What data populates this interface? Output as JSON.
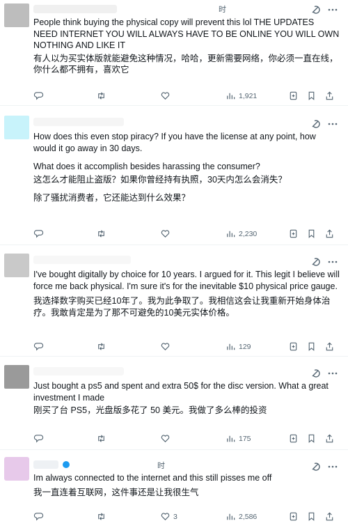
{
  "posts": [
    {
      "avatar_color": "#bdbdbd",
      "time": "时",
      "lines": [
        "People think buying the physical copy will prevent this lol THE UPDATES NEED INTERNET YOU WILL ALWAYS HAVE TO BE ONLINE YOU WILL OWN NOTHING AND LIKE IT",
        "有人以为买实体版就能避免这种情况，哈哈，更新需要网络，你必须一直在线，你什么都不拥有，喜欢它"
      ],
      "reply_count": "",
      "retweet_count": "",
      "like_count": "",
      "view_count": "1,921"
    },
    {
      "avatar_color": "#c8f3fb",
      "time": "",
      "lines": [
        "How does this even stop piracy? If you have the license at any point, how would it go away in 30 days.",
        "What does it accomplish besides harassing the consumer?",
        "这怎么才能阻止盗版？如果你曾经持有执照，30天内怎么会消失？",
        "除了骚扰消费者，它还能达到什么效果？"
      ],
      "reply_count": "",
      "retweet_count": "",
      "like_count": "",
      "view_count": "2,230"
    },
    {
      "avatar_color": "#c9c9c9",
      "time": "",
      "lines": [
        "I've bought digitally by choice for 10 years. I argued for it. This legit I believe will force me back physical. I'm sure it's for the inevitable $10 physical price gauge.",
        "我选择数字购买已经10年了。我为此争取了。我相信这会让我重新开始身体治疗。我敢肯定是为了那不可避免的10美元实体价格。"
      ],
      "reply_count": "",
      "retweet_count": "",
      "like_count": "",
      "view_count": "129"
    },
    {
      "avatar_color": "#9a9a9a",
      "time": "",
      "lines": [
        "Just bought a ps5 and spent and extra 50$ for the disc version. What a great investment I made",
        "刚买了台 PS5，光盘版多花了 50 美元。我做了多么棒的投资"
      ],
      "reply_count": "",
      "retweet_count": "",
      "like_count": "",
      "view_count": "175"
    },
    {
      "avatar_color": "#e7c9ea",
      "time": "时",
      "lines": [
        "Im always connected to the internet and this still pisses me off",
        "我一直连着互联网，这件事还是让我很生气"
      ],
      "reply_count": "",
      "retweet_count": "",
      "like_count": "3",
      "view_count": "2,586"
    }
  ]
}
